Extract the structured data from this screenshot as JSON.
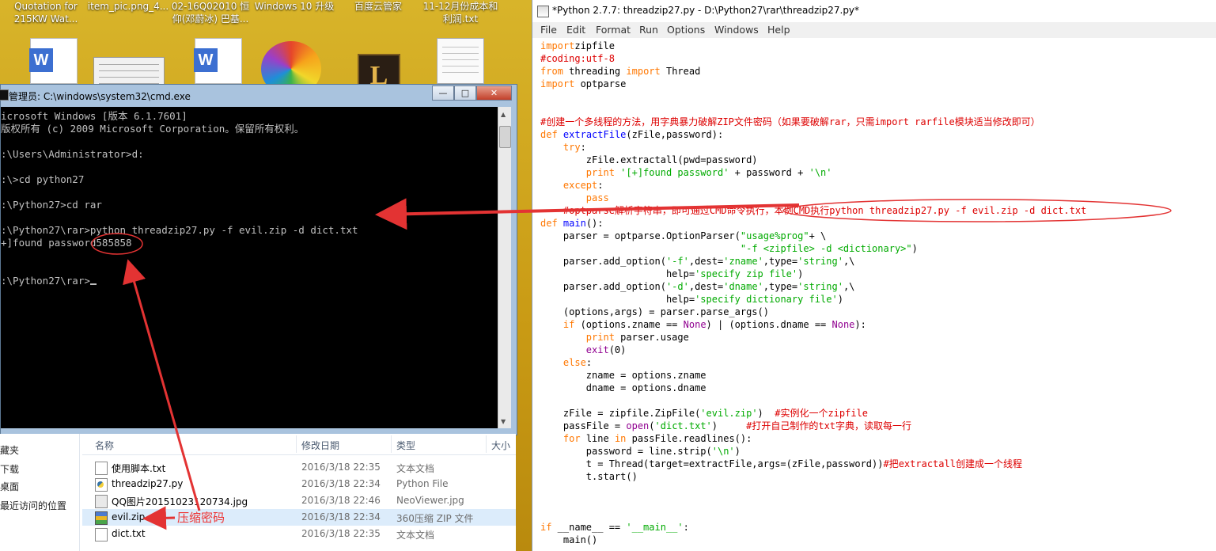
{
  "desktop": {
    "items": [
      {
        "label1": "Quotation for",
        "label2": "215KW Wat...",
        "icon": "wps-doc-icon"
      },
      {
        "label1": "item_pic.png_4...",
        "label2": "",
        "icon": "image-thumbnail-icon"
      },
      {
        "label1": "02-16Q02010 恒",
        "label2": "仰(邓蔚冰) 巴基...",
        "icon": "wps-doc-icon"
      },
      {
        "label1": "Windows 10 升级",
        "label2": "",
        "icon": "colorful-ball-icon"
      },
      {
        "label1": "百度云管家",
        "label2": "",
        "icon": "league-game-icon"
      },
      {
        "label1": "11-12月份成本和",
        "label2": "利润.txt",
        "icon": "text-file-icon"
      }
    ],
    "game_letter": "L",
    "wps_letter": "W"
  },
  "cmd": {
    "title": "管理员: C:\\windows\\system32\\cmd.exe",
    "buttons": {
      "minimize": "—",
      "maximize": "□",
      "close": "✕"
    },
    "lines": [
      "icrosoft Windows [版本 6.1.7601]",
      "版权所有 (c) 2009 Microsoft Corporation。保留所有权利。",
      ":\\Users\\Administrator>d:",
      ":\\>cd python27",
      ":\\Python27>cd rar",
      ":\\Python27\\rar>python threadzip27.py -f evil.zip -d dict.txt",
      "+]found password585858",
      ":\\Python27\\rar>"
    ]
  },
  "explorer": {
    "nav": [
      "藏夹",
      "下载",
      "桌面",
      "最近访问的位置"
    ],
    "columns": {
      "name": "名称",
      "date": "修改日期",
      "type": "类型",
      "size": "大小"
    },
    "files": [
      {
        "name": "使用脚本.txt",
        "date": "2016/3/18 22:35",
        "type": "文本文档",
        "icon": "txt"
      },
      {
        "name": "threadzip27.py",
        "date": "2016/3/18 22:34",
        "type": "Python File",
        "icon": "py"
      },
      {
        "name": "QQ图片20151023120734.jpg",
        "date": "2016/3/18 22:46",
        "type": "NeoViewer.jpg",
        "icon": "img"
      },
      {
        "name": "evil.zip",
        "date": "2016/3/18 22:34",
        "type": "360压缩 ZIP 文件",
        "icon": "zip"
      },
      {
        "name": "dict.txt",
        "date": "2016/3/18 22:35",
        "type": "文本文档",
        "icon": "txt"
      }
    ]
  },
  "annotation": {
    "label": "压缩密码"
  },
  "idle": {
    "title": "*Python 2.7.7: threadzip27.py - D:\\Python27\\rar\\threadzip27.py*",
    "menu": [
      "File",
      "Edit",
      "Format",
      "Run",
      "Options",
      "Windows",
      "Help"
    ],
    "code": [
      [
        [
          "kw",
          "import"
        ],
        [
          "",
          "zipfile"
        ]
      ],
      [
        [
          "cm",
          "#coding:utf-8"
        ]
      ],
      [
        [
          "kw",
          "from"
        ],
        [
          "",
          " threading "
        ],
        [
          "kw",
          "import"
        ],
        [
          "",
          " Thread"
        ]
      ],
      [
        [
          "kw",
          "import"
        ],
        [
          "",
          " optparse"
        ]
      ],
      [],
      [],
      [
        [
          "cm",
          "#创建一个多线程的方法，用字典暴力破解ZIP文件密码（如果要破解rar，只需import rarfile模块适当修改即可）"
        ]
      ],
      [
        [
          "kw",
          "def"
        ],
        [
          "",
          " "
        ],
        [
          "df",
          "extractFile"
        ],
        [
          "",
          "(zFile,password):"
        ]
      ],
      [
        [
          "",
          "    "
        ],
        [
          "kw",
          "try"
        ],
        [
          "",
          ":"
        ]
      ],
      [
        [
          "",
          "        zFile.extractall(pwd=password)"
        ]
      ],
      [
        [
          "",
          "        "
        ],
        [
          "kw",
          "print"
        ],
        [
          "",
          " "
        ],
        [
          "st",
          "'[+]found password'"
        ],
        [
          "",
          " + password + "
        ],
        [
          "st",
          "'\\n'"
        ]
      ],
      [
        [
          "",
          "    "
        ],
        [
          "kw",
          "except"
        ],
        [
          "",
          ":"
        ]
      ],
      [
        [
          "",
          "        "
        ],
        [
          "kw",
          "pass"
        ]
      ],
      [
        [
          "",
          "    "
        ],
        [
          "cm",
          "#optparse解析字符串，即可通过CMD命令执行，本例CMD执行python threadzip27.py -f evil.zip -d dict.txt"
        ]
      ],
      [
        [
          "kw",
          "def"
        ],
        [
          "",
          " "
        ],
        [
          "df",
          "main"
        ],
        [
          "",
          "():"
        ]
      ],
      [
        [
          "",
          "    parser = optparse.OptionParser("
        ],
        [
          "st",
          "\"usage%prog\""
        ],
        [
          "",
          "+ \\"
        ]
      ],
      [
        [
          "",
          "                                   "
        ],
        [
          "st",
          "\"-f <zipfile> -d <dictionary>\""
        ],
        [
          "",
          ")"
        ]
      ],
      [
        [
          "",
          "    parser.add_option("
        ],
        [
          "st",
          "'-f'"
        ],
        [
          "",
          ",dest="
        ],
        [
          "st",
          "'zname'"
        ],
        [
          "",
          ",type="
        ],
        [
          "st",
          "'string'"
        ],
        [
          "",
          ",\\"
        ]
      ],
      [
        [
          "",
          "                      help="
        ],
        [
          "st",
          "'specify zip file'"
        ],
        [
          "",
          ")"
        ]
      ],
      [
        [
          "",
          "    parser.add_option("
        ],
        [
          "st",
          "'-d'"
        ],
        [
          "",
          ",dest="
        ],
        [
          "st",
          "'dname'"
        ],
        [
          "",
          ",type="
        ],
        [
          "st",
          "'string'"
        ],
        [
          "",
          ",\\"
        ]
      ],
      [
        [
          "",
          "                      help="
        ],
        [
          "st",
          "'specify dictionary file'"
        ],
        [
          "",
          ")"
        ]
      ],
      [
        [
          "",
          "    (options,args) = parser.parse_args()"
        ]
      ],
      [
        [
          "",
          "    "
        ],
        [
          "kw",
          "if"
        ],
        [
          "",
          " (options.zname == "
        ],
        [
          "bi",
          "None"
        ],
        [
          "",
          ") | (options.dname == "
        ],
        [
          "bi",
          "None"
        ],
        [
          "",
          "):"
        ]
      ],
      [
        [
          "",
          "        "
        ],
        [
          "kw",
          "print"
        ],
        [
          "",
          " parser.usage"
        ]
      ],
      [
        [
          "",
          "        "
        ],
        [
          "bi",
          "exit"
        ],
        [
          "",
          "(0)"
        ]
      ],
      [
        [
          "",
          "    "
        ],
        [
          "kw",
          "else"
        ],
        [
          "",
          ":"
        ]
      ],
      [
        [
          "",
          "        zname = options.zname"
        ]
      ],
      [
        [
          "",
          "        dname = options.dname"
        ]
      ],
      [],
      [
        [
          "",
          "    zFile = zipfile.ZipFile("
        ],
        [
          "st",
          "'evil.zip'"
        ],
        [
          "",
          ")  "
        ],
        [
          "cm",
          "#实例化一个zipfile"
        ]
      ],
      [
        [
          "",
          "    passFile = "
        ],
        [
          "bi",
          "open"
        ],
        [
          "",
          "("
        ],
        [
          "st",
          "'dict.txt'"
        ],
        [
          "",
          ")     "
        ],
        [
          "cm",
          "#打开自己制作的txt字典，读取每一行"
        ]
      ],
      [
        [
          "",
          "    "
        ],
        [
          "kw",
          "for"
        ],
        [
          "",
          " line "
        ],
        [
          "kw",
          "in"
        ],
        [
          "",
          " passFile.readlines():"
        ]
      ],
      [
        [
          "",
          "        password = line.strip("
        ],
        [
          "st",
          "'\\n'"
        ],
        [
          "",
          ")"
        ]
      ],
      [
        [
          "",
          "        t = Thread(target=extractFile,args=(zFile,password))"
        ],
        [
          "cm",
          "#把extractall创建成一个线程"
        ]
      ],
      [
        [
          "",
          "        t.start()"
        ]
      ],
      [],
      [],
      [],
      [
        [
          "kw",
          "if"
        ],
        [
          "",
          " __name__ == "
        ],
        [
          "st",
          "'__main__'"
        ],
        [
          "",
          ":"
        ]
      ],
      [
        [
          "",
          "    main()"
        ]
      ]
    ]
  },
  "colors": {
    "accent_red": "#e33333",
    "console_bg": "#000000",
    "desktop_bg": "#c9a21a"
  }
}
